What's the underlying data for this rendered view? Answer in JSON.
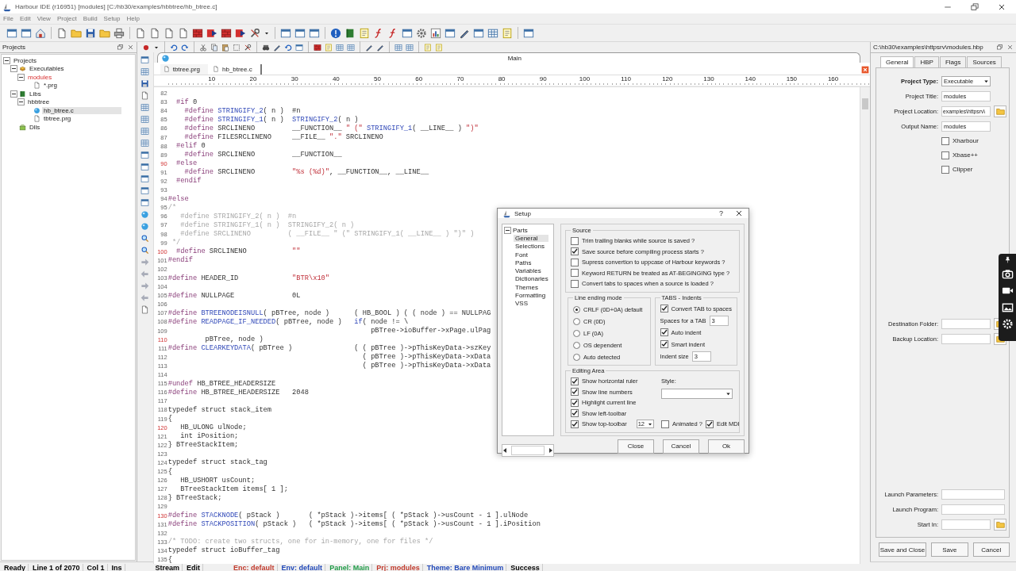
{
  "window": {
    "title": "Harbour IDE (r16951) [modules]  [C:/hb30/examples/hbbtree/hb_btree.c]"
  },
  "menu": [
    "File",
    "Edit",
    "View",
    "Project",
    "Build",
    "Setup",
    "Help"
  ],
  "projects_panel": {
    "title": "Projects",
    "tree": [
      {
        "label": "Projects",
        "selected": false,
        "active": false,
        "expanded": true,
        "children": [
          {
            "label": "Executables",
            "kind": "executables",
            "selected": false,
            "active": false,
            "expanded": true,
            "children": [
              {
                "label": "modules",
                "selected": false,
                "active": true,
                "expanded": true,
                "children": [
                  {
                    "label": "*.prg",
                    "kind": "prg",
                    "selected": false,
                    "active": false
                  }
                ]
              }
            ]
          },
          {
            "label": "Libs",
            "kind": "libs",
            "selected": false,
            "active": false,
            "expanded": true,
            "children": [
              {
                "label": "hbbtree",
                "selected": false,
                "active": false,
                "expanded": true,
                "children": [
                  {
                    "label": "hb_btree.c",
                    "kind": "c",
                    "selected": true,
                    "active": false
                  },
                  {
                    "label": "tbtree.prg",
                    "kind": "prg",
                    "selected": false,
                    "active": false
                  }
                ]
              }
            ]
          },
          {
            "label": "Dlls",
            "kind": "dlls",
            "selected": false,
            "active": false
          }
        ]
      }
    ]
  },
  "editor": {
    "main_tab": "Main",
    "file_tabs": [
      {
        "label": "tbtree.prg",
        "selected": false
      },
      {
        "label": "hb_btree.c",
        "selected": true
      }
    ],
    "ruler": [
      "10",
      "20",
      "30",
      "40",
      "50",
      "60",
      "70",
      "80",
      "90",
      "100",
      "110",
      "120",
      "130",
      "140",
      "150",
      "160"
    ],
    "lines": [
      {
        "number": "82",
        "changed": false
      },
      {
        "number": "83",
        "changed": false,
        "code": [
          {
            "kind": "directive",
            "text": "  #if"
          },
          {
            "kind": "plain",
            "text": " 0"
          }
        ]
      },
      {
        "number": "84",
        "changed": false,
        "code": [
          {
            "kind": "directive",
            "text": "    #define "
          },
          {
            "kind": "name",
            "text": "STRINGIFY_2"
          },
          {
            "kind": "plain",
            "text": "( n )  #n"
          }
        ]
      },
      {
        "number": "85",
        "changed": false,
        "code": [
          {
            "kind": "directive",
            "text": "    #define "
          },
          {
            "kind": "name",
            "text": "STRINGIFY_1"
          },
          {
            "kind": "plain",
            "text": "( n )  "
          },
          {
            "kind": "name",
            "text": "STRINGIFY_2"
          },
          {
            "kind": "plain",
            "text": "( n )"
          }
        ]
      },
      {
        "number": "86",
        "changed": false,
        "code": [
          {
            "kind": "directive",
            "text": "    #define "
          },
          {
            "kind": "plain",
            "text": "SRCLINENO         __FUNCTION__ "
          },
          {
            "kind": "string",
            "text": "\" (\""
          },
          {
            "kind": "name",
            "text": " STRINGIFY_1"
          },
          {
            "kind": "plain",
            "text": "( __LINE__ ) "
          },
          {
            "kind": "string",
            "text": "\")\""
          }
        ]
      },
      {
        "number": "87",
        "changed": false,
        "code": [
          {
            "kind": "directive",
            "text": "    #define "
          },
          {
            "kind": "plain",
            "text": "FILESRCLINENO     __FILE__ "
          },
          {
            "kind": "string",
            "text": "\".\""
          },
          {
            "kind": "plain",
            "text": " SRCLINENO"
          }
        ]
      },
      {
        "number": "88",
        "changed": false,
        "code": [
          {
            "kind": "directive",
            "text": "  #elif"
          },
          {
            "kind": "plain",
            "text": " 0"
          }
        ]
      },
      {
        "number": "89",
        "changed": false,
        "code": [
          {
            "kind": "directive",
            "text": "    #define "
          },
          {
            "kind": "plain",
            "text": "SRCLINENO         __FUNCTION__"
          }
        ]
      },
      {
        "number": "90",
        "changed": true,
        "code": [
          {
            "kind": "directive",
            "text": "  #else"
          }
        ]
      },
      {
        "number": "91",
        "changed": false,
        "code": [
          {
            "kind": "directive",
            "text": "    #define "
          },
          {
            "kind": "plain",
            "text": "SRCLINENO         "
          },
          {
            "kind": "string",
            "text": "\"%s (%d)\""
          },
          {
            "kind": "plain",
            "text": ", __FUNCTION__, __LINE__"
          }
        ]
      },
      {
        "number": "92",
        "changed": false,
        "code": [
          {
            "kind": "directive",
            "text": "  #endif"
          }
        ]
      },
      {
        "number": "93",
        "changed": false
      },
      {
        "number": "94",
        "changed": false,
        "code": [
          {
            "kind": "directive",
            "text": "#else"
          }
        ]
      },
      {
        "number": "95",
        "changed": false,
        "code": [
          {
            "kind": "comment",
            "text": "/*"
          }
        ]
      },
      {
        "number": "96",
        "changed": false,
        "code": [
          {
            "kind": "comment",
            "text": "   #define STRINGIFY_2( n )  #n"
          }
        ]
      },
      {
        "number": "97",
        "changed": false,
        "code": [
          {
            "kind": "comment",
            "text": "   #define STRINGIFY_1( n )  STRINGIFY_2( n )"
          }
        ]
      },
      {
        "number": "98",
        "changed": false,
        "code": [
          {
            "kind": "comment",
            "text": "   #define SRCLINENO         ( __FILE__ \" (\" STRINGIFY_1( __LINE__ ) \")\" )"
          }
        ]
      },
      {
        "number": "99",
        "changed": false,
        "code": [
          {
            "kind": "comment",
            "text": " */"
          }
        ]
      },
      {
        "number": "100",
        "changed": true,
        "code": [
          {
            "kind": "directive",
            "text": "  #define "
          },
          {
            "kind": "plain",
            "text": "SRCLINENO           "
          },
          {
            "kind": "string",
            "text": "\"\""
          }
        ]
      },
      {
        "number": "101",
        "changed": false,
        "code": [
          {
            "kind": "directive",
            "text": "#endif"
          }
        ]
      },
      {
        "number": "102",
        "changed": false
      },
      {
        "number": "103",
        "changed": false,
        "code": [
          {
            "kind": "directive",
            "text": "#define "
          },
          {
            "kind": "plain",
            "text": "HEADER_ID             "
          },
          {
            "kind": "string",
            "text": "\"BTR\\x10\""
          }
        ]
      },
      {
        "number": "104",
        "changed": false
      },
      {
        "number": "105",
        "changed": false,
        "code": [
          {
            "kind": "directive",
            "text": "#define "
          },
          {
            "kind": "plain",
            "text": "NULLPAGE              0L"
          }
        ]
      },
      {
        "number": "106",
        "changed": false
      },
      {
        "number": "107",
        "changed": false,
        "code": [
          {
            "kind": "directive",
            "text": "#define "
          },
          {
            "kind": "name",
            "text": "BTREENODEISNULL"
          },
          {
            "kind": "plain",
            "text": "( pBTree, node )      ( HB_BOOL ) ( ( node ) == NULLPAG"
          }
        ]
      },
      {
        "number": "108",
        "changed": false,
        "code": [
          {
            "kind": "directive",
            "text": "#define "
          },
          {
            "kind": "name",
            "text": "READPAGE_IF_NEEDED"
          },
          {
            "kind": "plain",
            "text": "( pBTree, node )   "
          },
          {
            "kind": "keyword",
            "text": "if"
          },
          {
            "kind": "plain",
            "text": "( node != \\"
          }
        ]
      },
      {
        "number": "109",
        "changed": false,
        "code": [
          {
            "kind": "plain",
            "text": "                                                 pBTree->ioBuffer->xPage.ulPag"
          }
        ]
      },
      {
        "number": "110",
        "changed": true,
        "code": [
          {
            "kind": "plain",
            "text": "         pBTree, node )"
          }
        ]
      },
      {
        "number": "111",
        "changed": false,
        "code": [
          {
            "kind": "directive",
            "text": "#define "
          },
          {
            "kind": "name",
            "text": "CLEARKEYDATA"
          },
          {
            "kind": "plain",
            "text": "( pBTree )               ( ( pBTree )->pThisKeyData->szKey"
          }
        ]
      },
      {
        "number": "112",
        "changed": false,
        "code": [
          {
            "kind": "plain",
            "text": "                                               ( pBTree )->pThisKeyData->xData"
          }
        ]
      },
      {
        "number": "113",
        "changed": false,
        "code": [
          {
            "kind": "plain",
            "text": "                                               ( pBTree )->pThisKeyData->xData"
          }
        ]
      },
      {
        "number": "114",
        "changed": false
      },
      {
        "number": "115",
        "changed": false,
        "code": [
          {
            "kind": "directive",
            "text": "#undef "
          },
          {
            "kind": "plain",
            "text": "HB_BTREE_HEADERSIZE"
          }
        ]
      },
      {
        "number": "116",
        "changed": false,
        "code": [
          {
            "kind": "directive",
            "text": "#define "
          },
          {
            "kind": "plain",
            "text": "HB_BTREE_HEADERSIZE   2048"
          }
        ]
      },
      {
        "number": "117",
        "changed": false
      },
      {
        "number": "118",
        "changed": false,
        "code": [
          {
            "kind": "plain",
            "text": "typedef struct stack_item"
          }
        ]
      },
      {
        "number": "119",
        "changed": false,
        "code": [
          {
            "kind": "plain",
            "text": "{"
          }
        ]
      },
      {
        "number": "120",
        "changed": true,
        "code": [
          {
            "kind": "plain",
            "text": "   HB_ULONG ulNode;"
          }
        ]
      },
      {
        "number": "121",
        "changed": false,
        "code": [
          {
            "kind": "plain",
            "text": "   int iPosition;"
          }
        ]
      },
      {
        "number": "122",
        "changed": false,
        "code": [
          {
            "kind": "plain",
            "text": "} BTreeStackItem;"
          }
        ]
      },
      {
        "number": "123",
        "changed": false
      },
      {
        "number": "124",
        "changed": false,
        "code": [
          {
            "kind": "plain",
            "text": "typedef struct stack_tag"
          }
        ]
      },
      {
        "number": "125",
        "changed": false,
        "code": [
          {
            "kind": "plain",
            "text": "{"
          }
        ]
      },
      {
        "number": "126",
        "changed": false,
        "code": [
          {
            "kind": "plain",
            "text": "   HB_USHORT usCount;"
          }
        ]
      },
      {
        "number": "127",
        "changed": false,
        "code": [
          {
            "kind": "plain",
            "text": "   BTreeStackItem items[ 1 ];"
          }
        ]
      },
      {
        "number": "128",
        "changed": false,
        "code": [
          {
            "kind": "plain",
            "text": "} BTreeStack;"
          }
        ]
      },
      {
        "number": "129",
        "changed": false
      },
      {
        "number": "130",
        "changed": true,
        "code": [
          {
            "kind": "directive",
            "text": "#define "
          },
          {
            "kind": "name",
            "text": "STACKNODE"
          },
          {
            "kind": "plain",
            "text": "( pStack )       ( *pStack )->items[ ( *pStack )->usCount - 1 ].ulNode"
          }
        ]
      },
      {
        "number": "131",
        "changed": false,
        "code": [
          {
            "kind": "directive",
            "text": "#define "
          },
          {
            "kind": "name",
            "text": "STACKPOSITION"
          },
          {
            "kind": "plain",
            "text": "( pStack )   ( *pStack )->items[ ( *pStack )->usCount - 1 ].iPosition"
          }
        ]
      },
      {
        "number": "132",
        "changed": false
      },
      {
        "number": "133",
        "changed": false,
        "code": [
          {
            "kind": "comment",
            "text": "/* TODO: create two structs, one for in-memory, one for files */"
          }
        ]
      },
      {
        "number": "134",
        "changed": false,
        "code": [
          {
            "kind": "plain",
            "text": "typedef struct ioBuffer_tag"
          }
        ]
      },
      {
        "number": "135",
        "changed": false,
        "code": [
          {
            "kind": "plain",
            "text": "{"
          }
        ]
      }
    ]
  },
  "setup_dialog": {
    "title": "Setup",
    "help": "?",
    "tree": {
      "label": "Parts",
      "expanded": true,
      "children": [
        {
          "label": "General",
          "selected": true
        },
        {
          "label": "Selections",
          "selected": false
        },
        {
          "label": "Font",
          "selected": false
        },
        {
          "label": "Paths",
          "selected": false
        },
        {
          "label": "Variables",
          "selected": false
        },
        {
          "label": "Dictionaries",
          "selected": false
        },
        {
          "label": "Themes",
          "selected": false
        },
        {
          "label": "Formatting",
          "selected": false
        },
        {
          "label": "VSS",
          "selected": false
        }
      ]
    },
    "source": {
      "title": "Source",
      "options": [
        {
          "label": "Trim trailing blanks while source is saved ?",
          "checked": false
        },
        {
          "label": "Save source before compiling process starts ?",
          "checked": true
        },
        {
          "label": "Supress convertion to uppcase of Harbour keywords ?",
          "checked": false
        },
        {
          "label": "Keyword RETURN be treated as AT-BEGINGING type ?",
          "checked": false
        },
        {
          "label": "Convert tabs to spaces when a source is loaded ?",
          "checked": false
        }
      ]
    },
    "line_ending": {
      "title": "Line ending mode",
      "options": [
        {
          "label": "CRLF (0D+0A) default",
          "selected": true
        },
        {
          "label": "CR (0D)",
          "selected": false
        },
        {
          "label": "LF (0A)",
          "selected": false
        },
        {
          "label": "OS dependent",
          "selected": false
        },
        {
          "label": "Auto detected",
          "selected": false
        }
      ]
    },
    "tabs_indents": {
      "title": "TABS - Indents",
      "items": [
        {
          "kind": "checkbox",
          "label": "Convert TAB to spaces",
          "checked": true
        },
        {
          "kind": "field",
          "label": "Spaces for a TAB",
          "value": "3"
        },
        {
          "kind": "checkbox",
          "label": "Auto indent",
          "checked": true
        },
        {
          "kind": "checkbox",
          "label": "Smart indent",
          "checked": true
        },
        {
          "kind": "field",
          "label": "Indent size",
          "value": "3"
        }
      ]
    },
    "editing_area": {
      "title": "Editing Area",
      "options": [
        {
          "label": "Show horizontal ruler",
          "checked": true
        },
        {
          "label": "Show line numbers",
          "checked": true
        },
        {
          "label": "Highlight current line",
          "checked": true
        },
        {
          "label": "Show left-toolbar",
          "checked": true
        },
        {
          "label": "Show top-toolbar",
          "checked": true
        }
      ],
      "toolbar_size": "12",
      "style_label": "Style:",
      "animated": {
        "label": "Animated ?",
        "checked": false
      },
      "edit_mdi": {
        "label": "Edit MDI",
        "checked": true
      }
    },
    "buttons": [
      "Close",
      "Cancel",
      "Ok"
    ]
  },
  "project_panel": {
    "title": "C:\\hb30\\examples\\httpsrv\\modules.hbp",
    "tabs": [
      {
        "label": "General",
        "selected": true
      },
      {
        "label": "HBP",
        "selected": false
      },
      {
        "label": "Flags",
        "selected": false
      },
      {
        "label": "Sources",
        "selected": false
      }
    ],
    "fields": [
      {
        "kind": "dropdown",
        "label": "Project Type:",
        "value": "Executable"
      },
      {
        "kind": "text",
        "label": "Project Title:",
        "value": "modules"
      },
      {
        "kind": "folder",
        "label": "Project Location:",
        "value": "examples\\httpsrv\\"
      },
      {
        "kind": "text",
        "label": "Output Name:",
        "value": "modules"
      }
    ],
    "checkboxes": [
      {
        "label": "Xharbour",
        "checked": false
      },
      {
        "label": "Xbase++",
        "checked": false
      },
      {
        "label": "Clipper",
        "checked": false
      }
    ],
    "location_fields": [
      {
        "kind": "folder",
        "label": "Destination Folder:"
      },
      {
        "kind": "folder",
        "label": "Backup Location:"
      }
    ],
    "launch_fields": [
      {
        "kind": "text",
        "label": "Launch Parameters:"
      },
      {
        "kind": "text",
        "label": "Launch Program:"
      },
      {
        "kind": "folder",
        "label": "Start In:"
      }
    ],
    "buttons": [
      "Save and Close",
      "Save",
      "Cancel"
    ]
  },
  "status_bar": {
    "items": [
      {
        "text": "Ready",
        "color": "#000000"
      },
      {
        "text": "Line 1 of 2070",
        "color": "#000000"
      },
      {
        "text": "Col 1",
        "color": "#000000"
      },
      {
        "text": "Ins",
        "color": "#000000"
      },
      {
        "text": "Stream",
        "color": "#000000"
      },
      {
        "text": "Edit",
        "color": "#000000"
      },
      {
        "text": "Enc: default",
        "color": "#c0392b"
      },
      {
        "text": "Env: default",
        "color": "#2148b8"
      },
      {
        "text": "Panel: Main",
        "color": "#1e9a45"
      },
      {
        "text": "Prj: modules",
        "color": "#c0392b"
      },
      {
        "text": "Theme: Bare Minimum",
        "color": "#2148b8"
      },
      {
        "text": "Success",
        "color": "#000000"
      }
    ]
  }
}
